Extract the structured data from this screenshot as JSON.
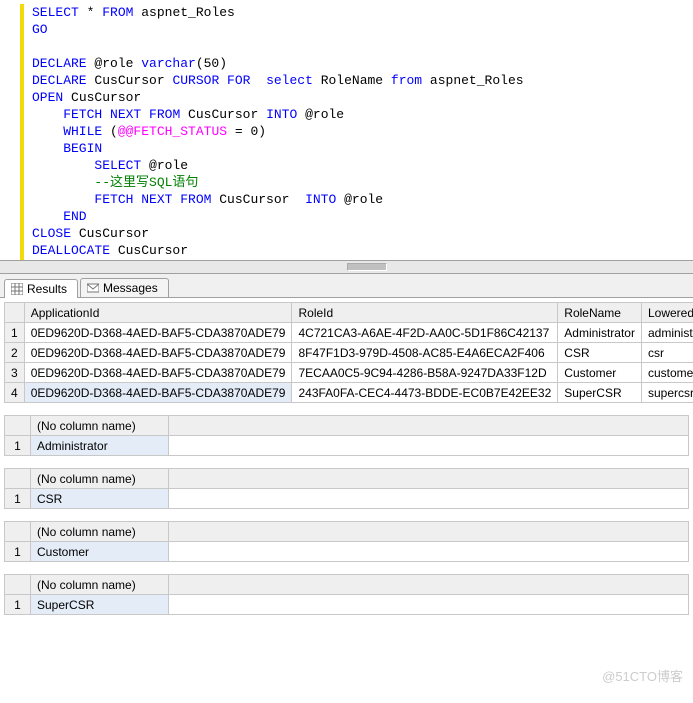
{
  "code": {
    "l1_a": "SELECT",
    "l1_b": " * ",
    "l1_c": "FROM",
    "l1_d": " aspnet_Roles",
    "l2": "GO",
    "l4_a": "DECLARE",
    "l4_b": " @role ",
    "l4_c": "varchar",
    "l4_d": "(50)",
    "l5_a": "DECLARE",
    "l5_b": " CusCursor ",
    "l5_c": "CURSOR",
    "l5_d": " FOR",
    "l5_e": "  select",
    "l5_f": " RoleName ",
    "l5_g": "from",
    "l5_h": " aspnet_Roles",
    "l6_a": "OPEN",
    "l6_b": " CusCursor",
    "l7_a": "    FETCH",
    "l7_b": " NEXT",
    "l7_c": " FROM",
    "l7_d": " CusCursor ",
    "l7_e": "INTO",
    "l7_f": " @role",
    "l8_a": "    WHILE",
    "l8_b": " (",
    "l8_c": "@@FETCH_STATUS",
    "l8_d": " = 0)",
    "l9": "    BEGIN",
    "l10_a": "        SELECT",
    "l10_b": " @role",
    "l11": "        --这里写SQL语句",
    "l12_a": "        FETCH",
    "l12_b": " NEXT",
    "l12_c": " FROM",
    "l12_d": " CusCursor  ",
    "l12_e": "INTO",
    "l12_f": " @role",
    "l13": "    END",
    "l14_a": "CLOSE",
    "l14_b": " CusCursor",
    "l15_a": "DEALLOCATE",
    "l15_b": " CusCursor"
  },
  "tabs": {
    "results": "Results",
    "messages": "Messages"
  },
  "grid1": {
    "headers": [
      "ApplicationId",
      "RoleId",
      "RoleName",
      "LoweredRoleName"
    ],
    "rows": [
      {
        "n": "1",
        "app": "0ED9620D-D368-4AED-BAF5-CDA3870ADE79",
        "role": "4C721CA3-A6AE-4F2D-AA0C-5D1F86C42137",
        "name": "Administrator",
        "low": "administrator"
      },
      {
        "n": "2",
        "app": "0ED9620D-D368-4AED-BAF5-CDA3870ADE79",
        "role": "8F47F1D3-979D-4508-AC85-E4A6ECA2F406",
        "name": "CSR",
        "low": "csr"
      },
      {
        "n": "3",
        "app": "0ED9620D-D368-4AED-BAF5-CDA3870ADE79",
        "role": "7ECAA0C5-9C94-4286-B58A-9247DA33F12D",
        "name": "Customer",
        "low": "customer"
      },
      {
        "n": "4",
        "app": "0ED9620D-D368-4AED-BAF5-CDA3870ADE79",
        "role": "243FA0FA-CEC4-4473-BDDE-EC0B7E42EE32",
        "name": "SuperCSR",
        "low": "supercsr"
      }
    ]
  },
  "smallGrids": {
    "header": "(No column name)",
    "r1": "Administrator",
    "r2": "CSR",
    "r3": "Customer",
    "r4": "SuperCSR"
  },
  "watermark": "@51CTO博客"
}
